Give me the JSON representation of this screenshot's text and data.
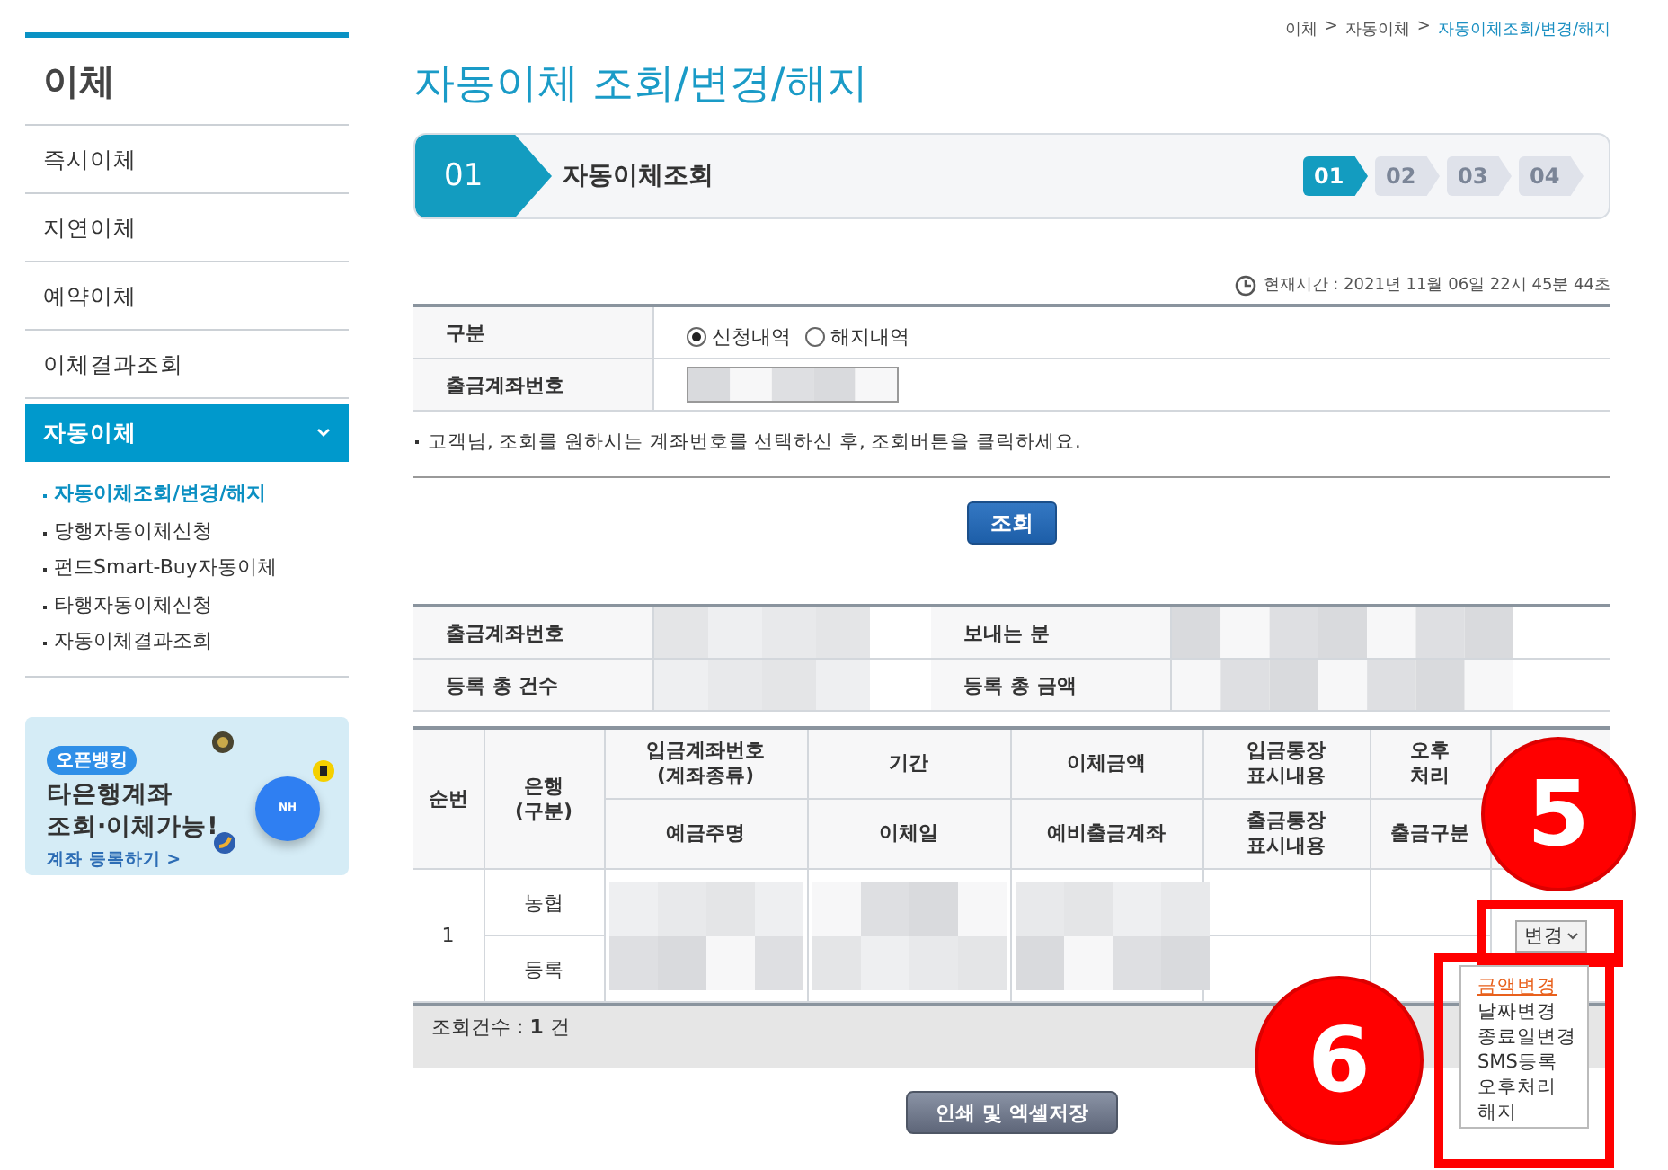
{
  "sidebar": {
    "title": "이체",
    "items": [
      {
        "label": "즉시이체",
        "selected": false
      },
      {
        "label": "지연이체",
        "selected": false
      },
      {
        "label": "예약이체",
        "selected": false
      },
      {
        "label": "이체결과조회",
        "selected": false
      },
      {
        "label": "자동이체",
        "selected": true,
        "expanded": true,
        "children": [
          {
            "label": "자동이체조회/변경/해지",
            "selected": true
          },
          {
            "label": "당행자동이체신청",
            "selected": false
          },
          {
            "label": "펀드Smart-Buy자동이체",
            "selected": false
          },
          {
            "label": "타행자동이체신청",
            "selected": false
          },
          {
            "label": "자동이체결과조회",
            "selected": false
          }
        ]
      }
    ]
  },
  "banner": {
    "badge": "오픈뱅킹",
    "headline": [
      "타은행계좌",
      "조회·이체가능!"
    ],
    "link": "계좌 등록하기 >",
    "logo_text": "NH"
  },
  "breadcrumb": {
    "separator": ">",
    "items": [
      {
        "label": "이체",
        "current": false
      },
      {
        "label": "자동이체",
        "current": false
      },
      {
        "label": "자동이체조회/변경/해지",
        "current": true
      }
    ]
  },
  "page_title": "자동이체 조회/변경/해지",
  "steps": {
    "current_number": "01",
    "current_label": "자동이체조회",
    "items": [
      {
        "label": "01",
        "selected": true
      },
      {
        "label": "02",
        "selected": false
      },
      {
        "label": "03",
        "selected": false
      },
      {
        "label": "04",
        "selected": false
      }
    ]
  },
  "current_time": "현재시간 : 2021년 11월 06일 22시 45분 44초",
  "search_form": {
    "rows": [
      {
        "label": "구분",
        "kind": "radio",
        "options": [
          {
            "label": "신청내역",
            "selected": true
          },
          {
            "label": "해지내역",
            "selected": false
          }
        ]
      },
      {
        "label": "출금계좌번호",
        "kind": "select"
      }
    ]
  },
  "notice": "고객님, 조회를 원하시는 계좌번호를 선택하신 후, 조회버튼을 클릭하세요.",
  "search_button": "조회",
  "summary": [
    {
      "label": "출금계좌번호"
    },
    {
      "label": "보내는 분"
    },
    {
      "label": "등록 총 건수"
    },
    {
      "label": "등록 총 금액"
    }
  ],
  "table": {
    "columns": [
      {
        "top": [
          "순번"
        ]
      },
      {
        "top": [
          "은행",
          "(구분)"
        ]
      },
      {
        "top": [
          "입금계좌번호",
          "(계좌종류)"
        ],
        "bottom": [
          "예금주명"
        ]
      },
      {
        "top": [
          "기간"
        ],
        "bottom": [
          "이체일"
        ]
      },
      {
        "top": [
          "이체금액"
        ],
        "bottom": [
          "예비출금계좌"
        ]
      },
      {
        "top": [
          "입금통장",
          "표시내용"
        ],
        "bottom": [
          "출금통장",
          "표시내용"
        ]
      },
      {
        "top": [
          "오후",
          "처리"
        ],
        "bottom": [
          "출금구분"
        ]
      },
      {}
    ],
    "rows": [
      {
        "number": "1",
        "bank": "농협",
        "status": "등록",
        "change_select": "변경"
      }
    ]
  },
  "result_count": "조회건수 : **1** 건",
  "dropdown": {
    "items": [
      {
        "label": "금액변경",
        "selected": true
      },
      {
        "label": "날짜변경",
        "selected": false
      },
      {
        "label": "종료일변경",
        "selected": false
      },
      {
        "label": "SMS등록",
        "selected": false
      },
      {
        "label": "오후처리",
        "selected": false
      },
      {
        "label": "해지",
        "selected": false
      }
    ]
  },
  "print_button": "인쇄 및 엑셀저장",
  "annotations": [
    {
      "label": "5"
    },
    {
      "label": "6"
    }
  ]
}
